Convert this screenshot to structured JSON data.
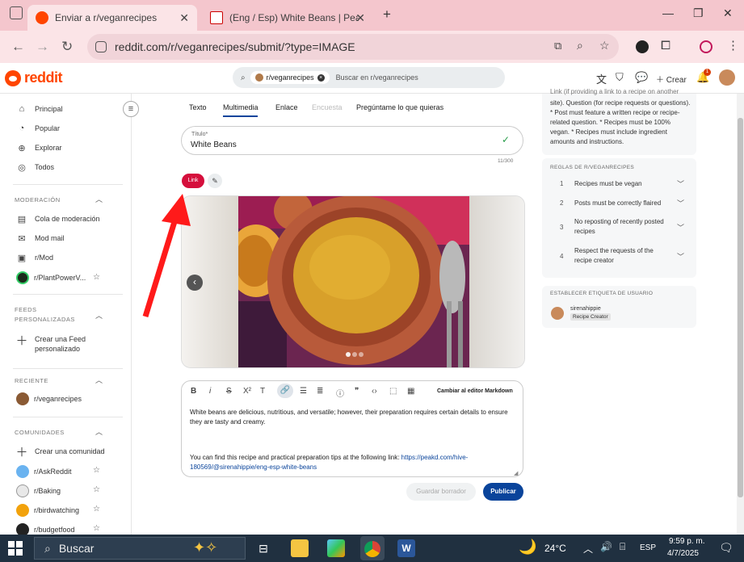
{
  "browser": {
    "tabs": [
      {
        "title": "Enviar a r/veganrecipes",
        "active": true
      },
      {
        "title": "(Eng / Esp) White Beans | PeakD",
        "active": false
      }
    ],
    "new_tab": "+",
    "url": "reddit.com/r/veganrecipes/submit/?type=IMAGE"
  },
  "reddit": {
    "brand": "reddit",
    "search": {
      "community": "r/veganrecipes",
      "placeholder": "Buscar en r/veganrecipes"
    },
    "create_label": "Crear",
    "notif_count": "1"
  },
  "sidebar": {
    "main": [
      {
        "label": "Principal",
        "icon": "home-icon"
      },
      {
        "label": "Popular",
        "icon": "popular-icon"
      },
      {
        "label": "Explorar",
        "icon": "explore-icon"
      },
      {
        "label": "Todos",
        "icon": "all-icon"
      }
    ],
    "moderation_title": "MODERACIÓN",
    "moderation": [
      {
        "label": "Cola de moderación"
      },
      {
        "label": "Mod mail"
      },
      {
        "label": "r/Mod"
      },
      {
        "label": "r/PlantPowerV..."
      }
    ],
    "feeds_title": "FEEDS PERSONALIZADAS",
    "create_feed": "Crear una Feed personalizado",
    "recent_title": "RECIENTE",
    "recent": [
      {
        "label": "r/veganrecipes"
      }
    ],
    "communities_title": "COMUNIDADES",
    "create_community": "Crear una comunidad",
    "communities": [
      {
        "label": "r/AskReddit",
        "color": "#6ab3f0"
      },
      {
        "label": "r/Baking",
        "color": "#e8e8e8"
      },
      {
        "label": "r/birdwatching",
        "color": "#f2a20c"
      },
      {
        "label": "r/budgetfood",
        "color": "#222222"
      }
    ]
  },
  "post": {
    "tabs": [
      "Texto",
      "Multimedia",
      "Enlace",
      "Encuesta",
      "Pregúntame lo que quieras"
    ],
    "active_tab": "Multimedia",
    "title_label": "Título*",
    "title_value": "White Beans",
    "char_count": "11/300",
    "link_label": "Link",
    "switch_editor": "Cambiar al editor Markdown",
    "body_p1": "White beans are delicious, nutritious, and versatile; however, their preparation requires certain details to ensure they are tasty and creamy.",
    "body_p2_prefix": "You can find this recipe and practical preparation tips at the following link: ",
    "body_link": "https://peakd.com/hive-180569/@sirenahippie/eng-esp-white-beans",
    "save_draft": "Guardar borrador",
    "publish": "Publicar"
  },
  "rightbar": {
    "about_text": "site). Question (for recipe requests or questions). * Post must feature a written recipe or recipe-related question. * Recipes must be 100% vegan. * Recipes must include ingredient amounts and instructions.",
    "about_top": "Link (if providing a link to a recipe on another",
    "rules_title": "REGLAS DE R/VEGANRECIPES",
    "rules": [
      {
        "num": "1",
        "text": "Recipes must be vegan"
      },
      {
        "num": "2",
        "text": "Posts must be correctly flaired"
      },
      {
        "num": "3",
        "text": "No reposting of recently posted recipes"
      },
      {
        "num": "4",
        "text": "Respect the requests of the recipe creator"
      }
    ],
    "flair_title": "ESTABLECER ETIQUETA DE USUARIO",
    "username": "sirenahippie",
    "flair": "Recipe Creator"
  },
  "taskbar": {
    "search": "Buscar",
    "temp": "24°C",
    "lang": "ESP",
    "time": "9:59 p. m.",
    "date": "4/7/2025"
  },
  "colors": {
    "accent": "#d93a00",
    "publish": "#0a449b",
    "link_btn": "#d50f3c",
    "arrow": "#ff1a1a"
  }
}
